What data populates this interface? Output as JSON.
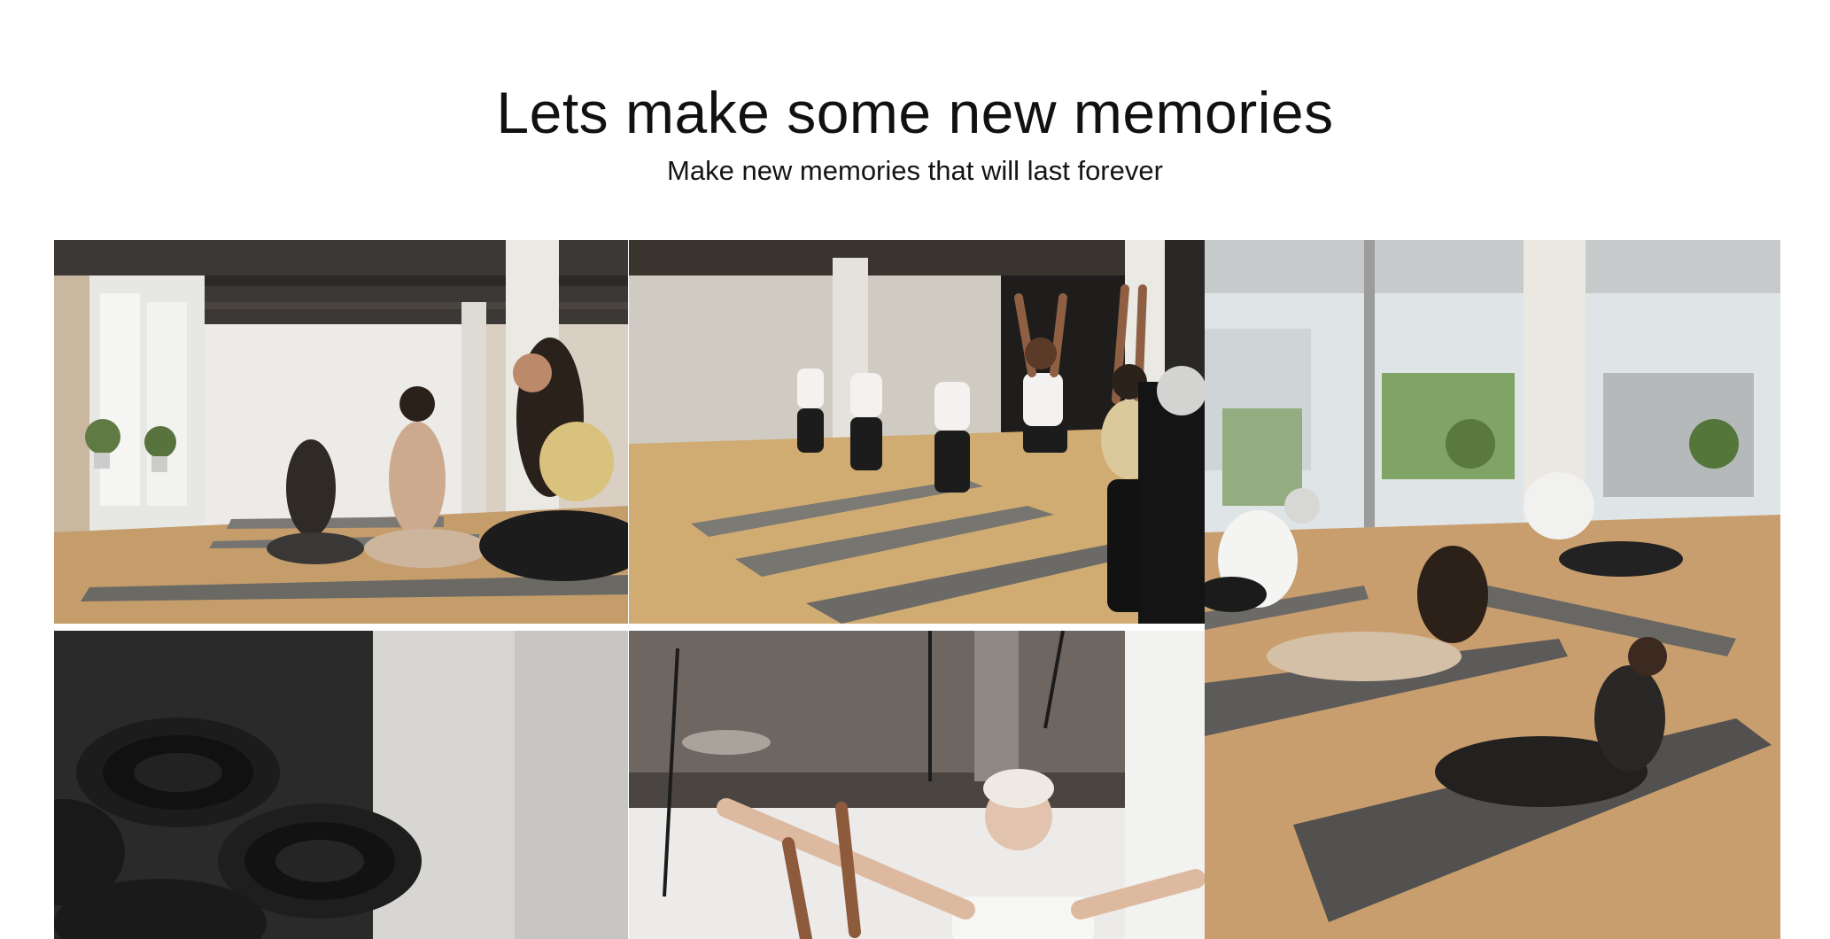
{
  "hero": {
    "title": "Lets make some new memories",
    "subtitle": "Make new memories that will last forever"
  },
  "gallery": {
    "photos": [
      {
        "subject": "group-seated-yoga-photo"
      },
      {
        "subject": "warrior-pose-class-photo"
      },
      {
        "subject": "upward-dog-pose-photo"
      },
      {
        "subject": "rolled-yoga-mats-photo"
      },
      {
        "subject": "instructor-arms-raised-photo"
      }
    ]
  },
  "colors": {
    "background": "#ffffff",
    "text": "#111111",
    "floor": "#c49d6b",
    "mat": "#6b6963",
    "ceiling": "#3c3835",
    "wall": "#efefef"
  }
}
